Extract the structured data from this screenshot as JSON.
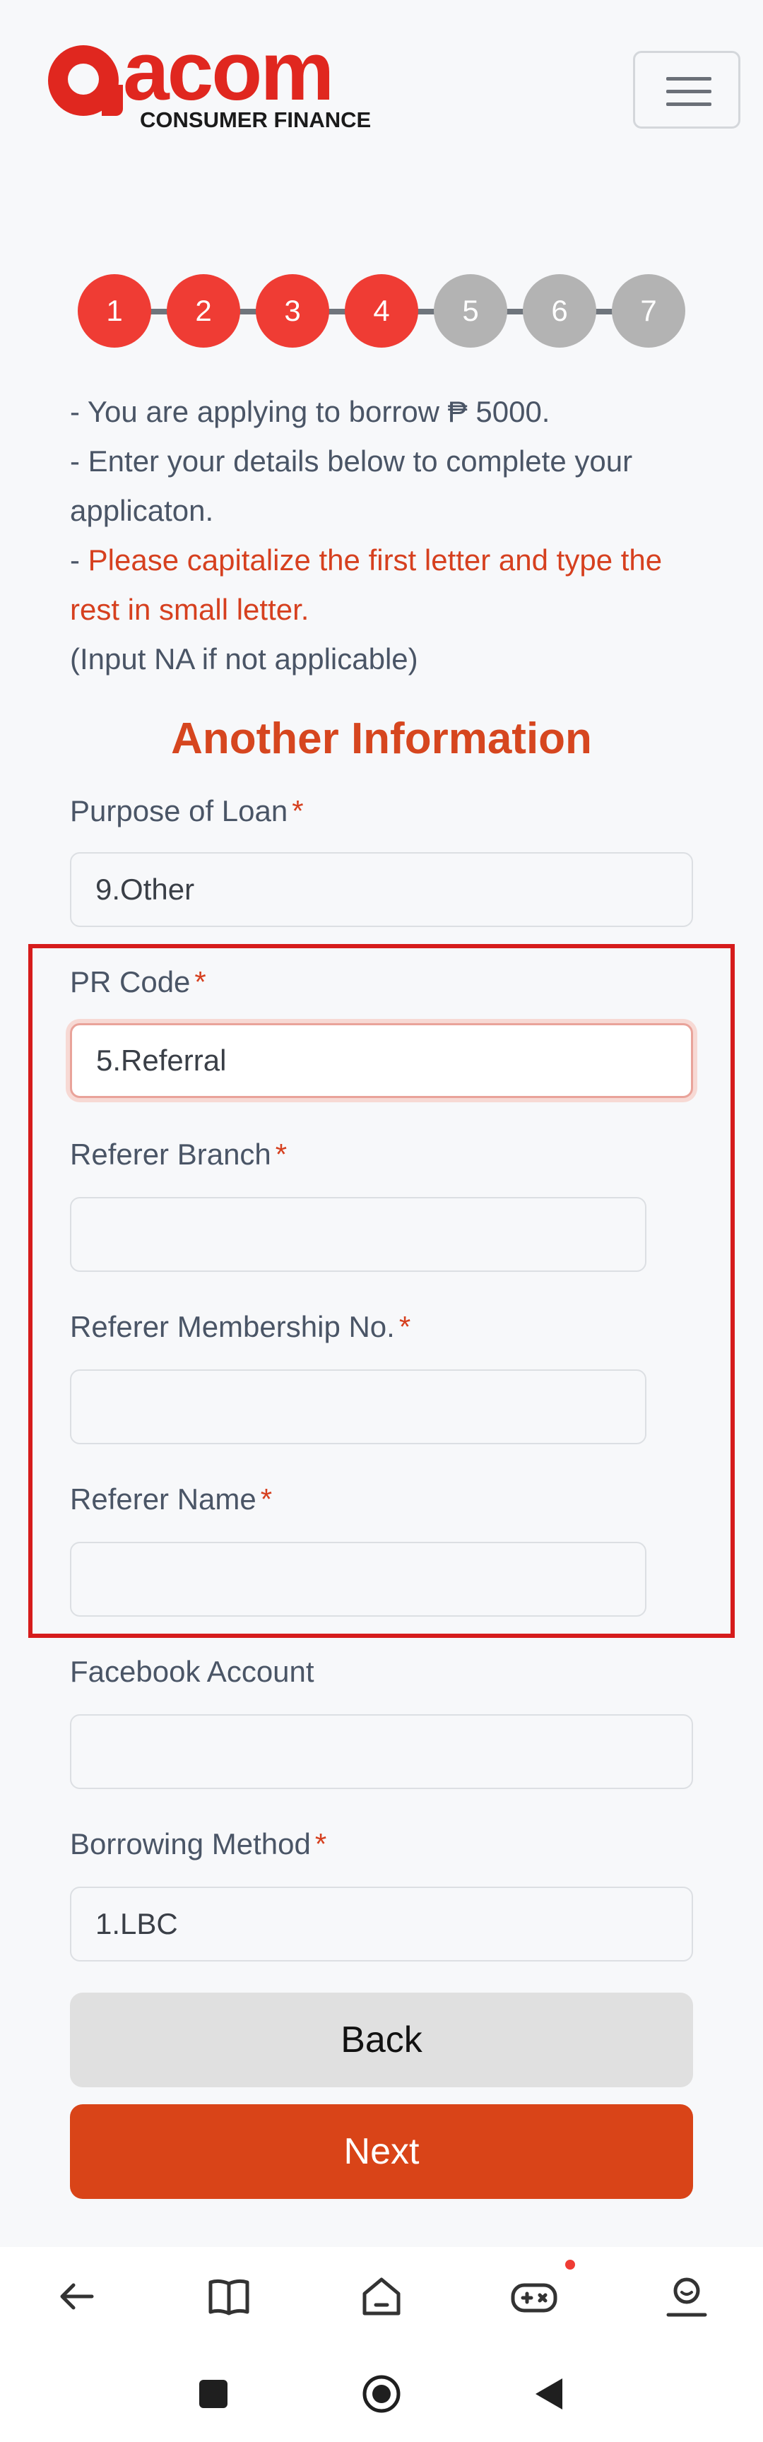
{
  "header": {
    "logo_word": "acom",
    "logo_sub": "CONSUMER FINANCE",
    "menu_icon": "hamburger-menu-icon"
  },
  "stepper": {
    "steps": [
      {
        "label": "1",
        "status": "active"
      },
      {
        "label": "2",
        "status": "active"
      },
      {
        "label": "3",
        "status": "active"
      },
      {
        "label": "4",
        "status": "active"
      },
      {
        "label": "5",
        "status": "inactive"
      },
      {
        "label": "6",
        "status": "inactive"
      },
      {
        "label": "7",
        "status": "inactive"
      }
    ]
  },
  "intro": {
    "line1": "- You are applying to borrow ₱ 5000.",
    "line2": "- Enter your details below to complete your applicaton.",
    "line3_prefix": "- ",
    "line3_warn": "Please capitalize the first letter and type the rest in small letter.",
    "line4": "(Input NA if not applicable)"
  },
  "section_title": "Another Information",
  "form": {
    "purpose": {
      "label": "Purpose of Loan",
      "required": "*",
      "value": "9.Other"
    },
    "pr_code": {
      "label": "PR Code",
      "required": "*",
      "value": "5.Referral"
    },
    "referer_branch": {
      "label": "Referer Branch",
      "required": "*",
      "value": ""
    },
    "referer_membership": {
      "label": "Referer Membership No.",
      "required": "*",
      "value": ""
    },
    "referer_name": {
      "label": "Referer Name",
      "required": "*",
      "value": ""
    },
    "facebook": {
      "label": "Facebook Account",
      "value": ""
    },
    "borrowing_method": {
      "label": "Borrowing Method",
      "required": "*",
      "value": "1.LBC"
    }
  },
  "buttons": {
    "back": "Back",
    "next": "Next"
  },
  "colors": {
    "brand_red": "#e0271f",
    "step_active": "#ef3c34",
    "step_inactive": "#b3b3b3",
    "next_button": "#d94418",
    "highlight": "#d61c1c"
  },
  "bottom_nav": {
    "items": [
      "back-arrow-icon",
      "book-icon",
      "home-icon",
      "gamepad-icon",
      "profile-icon"
    ]
  },
  "system_nav": {
    "items": [
      "recents-square-icon",
      "home-circle-icon",
      "back-triangle-icon"
    ]
  }
}
